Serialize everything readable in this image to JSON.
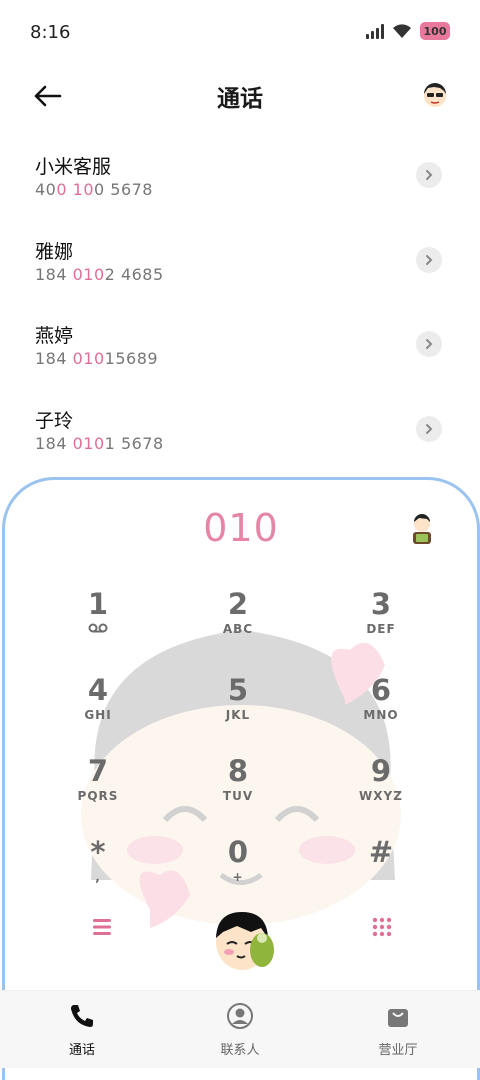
{
  "status": {
    "time": "8:16",
    "battery": "100"
  },
  "header": {
    "title": "通话"
  },
  "contacts": [
    {
      "name": "小米客服",
      "num_pre": "40",
      "num_hl1": "0",
      "num_mid": " ",
      "num_hl2": "10",
      "num_post": "0 5678"
    },
    {
      "name": "雅娜",
      "num_pre": "184 ",
      "num_hl1": "010",
      "num_mid": "",
      "num_hl2": "",
      "num_post": "2 4685"
    },
    {
      "name": "燕婷",
      "num_pre": "184 ",
      "num_hl1": "010",
      "num_mid": "",
      "num_hl2": "",
      "num_post": "15689"
    },
    {
      "name": "子玲",
      "num_pre": "184 ",
      "num_hl1": "010",
      "num_mid": "",
      "num_hl2": "",
      "num_post": "1 5678"
    }
  ],
  "dialer": {
    "digits": "010",
    "keys": [
      {
        "d": "1",
        "l": ""
      },
      {
        "d": "2",
        "l": "ABC"
      },
      {
        "d": "3",
        "l": "DEF"
      },
      {
        "d": "4",
        "l": "GHI"
      },
      {
        "d": "5",
        "l": "JKL"
      },
      {
        "d": "6",
        "l": "MNO"
      },
      {
        "d": "7",
        "l": "PQRS"
      },
      {
        "d": "8",
        "l": "TUV"
      },
      {
        "d": "9",
        "l": "WXYZ"
      },
      {
        "d": "*",
        "l": ","
      },
      {
        "d": "0",
        "l": "+"
      },
      {
        "d": "#",
        "l": ""
      }
    ]
  },
  "nav": [
    {
      "label": "通话",
      "icon": "phone-icon"
    },
    {
      "label": "联系人",
      "icon": "person-icon"
    },
    {
      "label": "营业厅",
      "icon": "bag-icon"
    }
  ],
  "colors": {
    "accent": "#e685a8",
    "border": "#9bc3ef"
  }
}
